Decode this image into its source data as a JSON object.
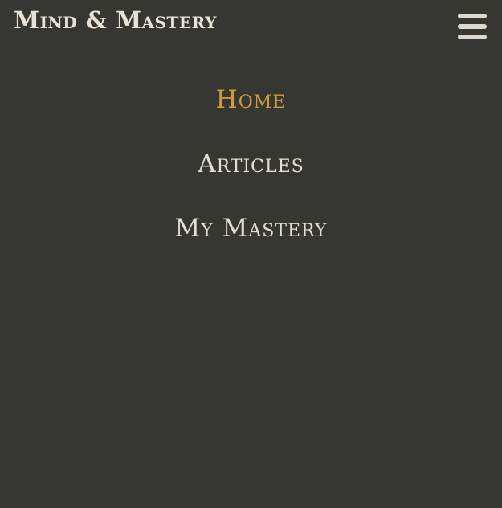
{
  "header": {
    "brand": "Mind & Mastery",
    "menu_icon": "hamburger-menu-icon"
  },
  "nav": {
    "items": [
      {
        "label": "Home",
        "active": true
      },
      {
        "label": "Articles",
        "active": false
      },
      {
        "label": "My Mastery",
        "active": false
      }
    ]
  },
  "colors": {
    "background": "#363633",
    "text": "#e3ddd2",
    "accent": "#cf9a3a"
  }
}
